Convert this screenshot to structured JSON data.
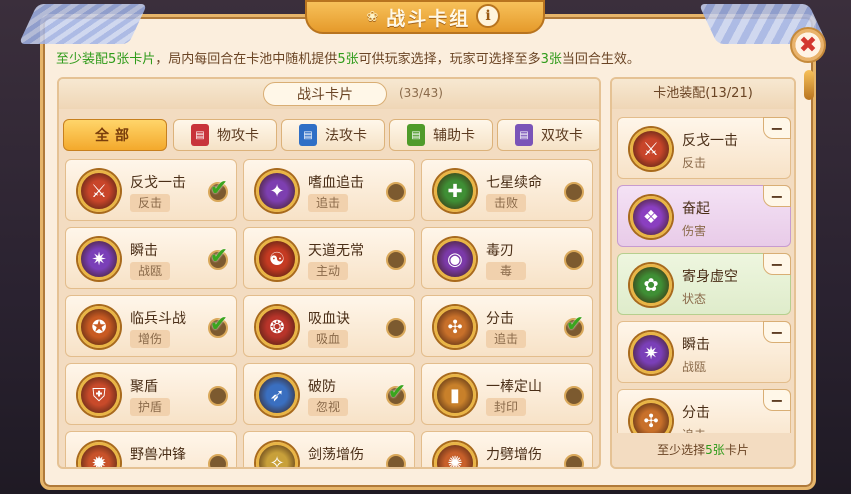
{
  "title": "战斗卡组",
  "title_deco": "❀",
  "info_icon": "i",
  "close_glyph": "✖",
  "notice": {
    "p1": "至少装配",
    "p2": "5张卡片",
    "p3": "，局内每回合在卡池中随机提供",
    "p4": "5张",
    "p5": "可供玩家选择，玩家可选择至多",
    "p6": "3张",
    "p7": "当回合生效。"
  },
  "left_pane": {
    "tag": "战斗卡片",
    "count": "(33/43)",
    "filters": [
      {
        "label": "全部",
        "book_color": ""
      },
      {
        "label": "物攻卡",
        "book_color": "#c8333a"
      },
      {
        "label": "法攻卡",
        "book_color": "#2f6fc6"
      },
      {
        "label": "辅助卡",
        "book_color": "#4f9b2a"
      },
      {
        "label": "双攻卡",
        "book_color": "#7a54b8"
      }
    ]
  },
  "cards": [
    {
      "name": "反戈一击",
      "type": "反击",
      "checked": true,
      "color": "#c8452a",
      "glyph": "⚔"
    },
    {
      "name": "嗜血追击",
      "type": "追击",
      "checked": false,
      "color": "#7d3fb0",
      "glyph": "✦"
    },
    {
      "name": "七星续命",
      "type": "击败",
      "checked": false,
      "color": "#3f8f35",
      "glyph": "✚"
    },
    {
      "name": "瞬击",
      "type": "战瓯",
      "checked": true,
      "color": "#7a3fb8",
      "glyph": "✷"
    },
    {
      "name": "天道无常",
      "type": "主动",
      "checked": false,
      "color": "#c43a22",
      "glyph": "☯"
    },
    {
      "name": "毒刃",
      "type": "毒",
      "checked": false,
      "color": "#7b3aa8",
      "glyph": "◉"
    },
    {
      "name": "临兵斗战",
      "type": "增伤",
      "checked": true,
      "color": "#c85a22",
      "glyph": "✪"
    },
    {
      "name": "吸血诀",
      "type": "吸血",
      "checked": false,
      "color": "#b8342a",
      "glyph": "❂"
    },
    {
      "name": "分击",
      "type": "追击",
      "checked": true,
      "color": "#c8702a",
      "glyph": "✣"
    },
    {
      "name": "聚盾",
      "type": "护盾",
      "checked": false,
      "color": "#c84a2a",
      "glyph": "⛨"
    },
    {
      "name": "破防",
      "type": "忽视",
      "checked": true,
      "color": "#3a6fc0",
      "glyph": "➶"
    },
    {
      "name": "一棒定山",
      "type": "封印",
      "checked": false,
      "color": "#c8802a",
      "glyph": "▮"
    },
    {
      "name": "野兽冲锋",
      "type": "",
      "checked": false,
      "color": "#c8522a",
      "glyph": "✹"
    },
    {
      "name": "剑荡增伤",
      "type": "",
      "checked": false,
      "color": "#c8a03a",
      "glyph": "✧"
    },
    {
      "name": "力劈增伤",
      "type": "",
      "checked": false,
      "color": "#c8602a",
      "glyph": "✺"
    }
  ],
  "right_pane": {
    "header": "卡池装配(13/21)",
    "slots": [
      {
        "name": "反戈一击",
        "type": "反击",
        "variant": "",
        "color": "#c8452a",
        "glyph": "⚔"
      },
      {
        "name": "奋起",
        "type": "伤害",
        "variant": "purple",
        "color": "#8a3fc0",
        "glyph": "❖"
      },
      {
        "name": "寄身虚空",
        "type": "状态",
        "variant": "green",
        "color": "#3f8f35",
        "glyph": "✿"
      },
      {
        "name": "瞬击",
        "type": "战瓯",
        "variant": "",
        "color": "#7a3fb8",
        "glyph": "✷"
      },
      {
        "name": "分击",
        "type": "追击",
        "variant": "",
        "color": "#c8702a",
        "glyph": "✣"
      }
    ],
    "footer_p1": "至少选择",
    "footer_p2": "5张",
    "footer_p3": "卡片"
  },
  "glyphs": {
    "check": "✔",
    "minus": "−"
  }
}
